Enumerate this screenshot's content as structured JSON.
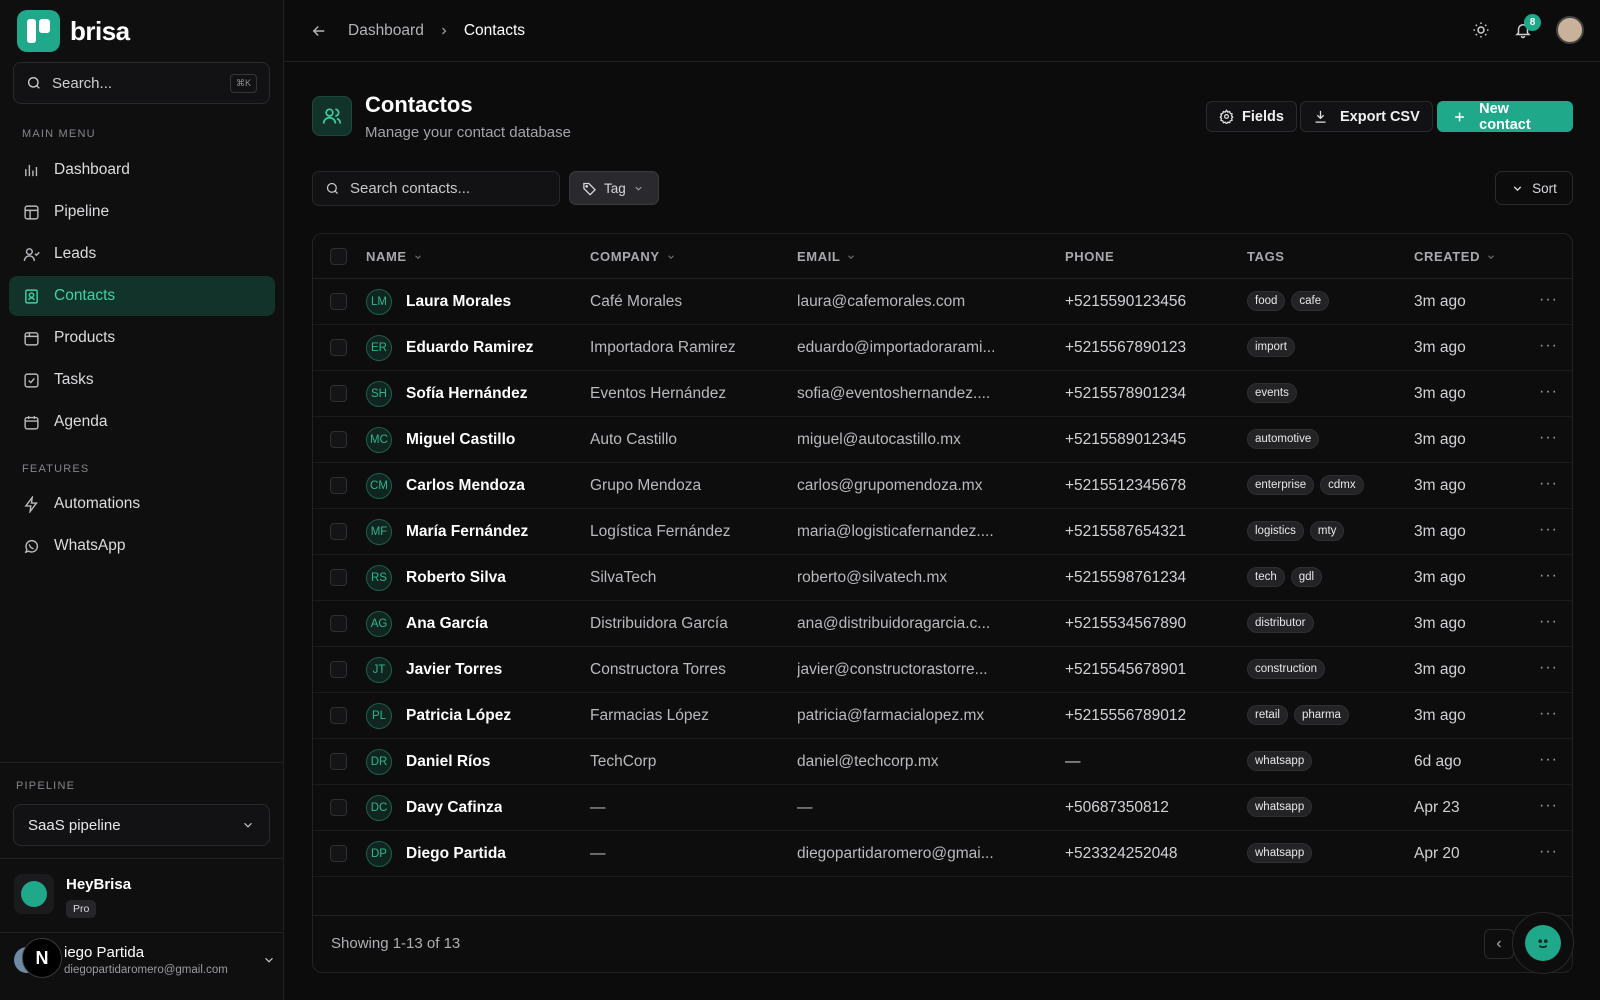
{
  "brand": {
    "name": "brisa"
  },
  "sidebar": {
    "search_placeholder": "Search...",
    "search_shortcut": "⌘K",
    "main_menu_label": "MAIN MENU",
    "main_items": [
      {
        "label": "Dashboard",
        "icon": "dashboard-icon"
      },
      {
        "label": "Pipeline",
        "icon": "pipeline-icon"
      },
      {
        "label": "Leads",
        "icon": "leads-icon"
      },
      {
        "label": "Contacts",
        "icon": "contacts-icon",
        "active": true
      },
      {
        "label": "Products",
        "icon": "products-icon"
      },
      {
        "label": "Tasks",
        "icon": "tasks-icon"
      },
      {
        "label": "Agenda",
        "icon": "calendar-icon"
      }
    ],
    "features_label": "FEATURES",
    "feature_items": [
      {
        "label": "Automations",
        "icon": "bolt-icon"
      },
      {
        "label": "WhatsApp",
        "icon": "whatsapp-icon"
      }
    ],
    "pipeline_label": "PIPELINE",
    "pipeline_selected": "SaaS pipeline",
    "org": {
      "name": "HeyBrisa",
      "plan": "Pro"
    },
    "user": {
      "name": "iego Partida",
      "email": "diegopartidaromero@gmail.com"
    },
    "next_badge": "N"
  },
  "topbar": {
    "breadcrumb": [
      "Dashboard",
      "Contacts"
    ],
    "notifications_count": "8"
  },
  "page": {
    "title": "Contactos",
    "subtitle": "Manage your contact database",
    "fields_label": "Fields",
    "export_label": "Export CSV",
    "new_label": "New contact",
    "search_placeholder": "Search contacts...",
    "tag_filter_label": "Tag",
    "sort_label": "Sort"
  },
  "table": {
    "headers": {
      "name": "NAME",
      "company": "COMPANY",
      "email": "EMAIL",
      "phone": "PHONE",
      "tags": "TAGS",
      "created": "CREATED"
    },
    "rows": [
      {
        "initials": "LM",
        "name": "Laura Morales",
        "company": "Café Morales",
        "email": "laura@cafemorales.com",
        "phone": "+5215590123456",
        "tags": [
          "food",
          "cafe"
        ],
        "created": "3m ago"
      },
      {
        "initials": "ER",
        "name": "Eduardo Ramirez",
        "company": "Importadora Ramirez",
        "email": "eduardo@importadorarami...",
        "phone": "+5215567890123",
        "tags": [
          "import"
        ],
        "created": "3m ago"
      },
      {
        "initials": "SH",
        "name": "Sofía Hernández",
        "company": "Eventos Hernández",
        "email": "sofia@eventoshernandez....",
        "phone": "+5215578901234",
        "tags": [
          "events"
        ],
        "created": "3m ago"
      },
      {
        "initials": "MC",
        "name": "Miguel Castillo",
        "company": "Auto Castillo",
        "email": "miguel@autocastillo.mx",
        "phone": "+5215589012345",
        "tags": [
          "automotive"
        ],
        "created": "3m ago"
      },
      {
        "initials": "CM",
        "name": "Carlos Mendoza",
        "company": "Grupo Mendoza",
        "email": "carlos@grupomendoza.mx",
        "phone": "+5215512345678",
        "tags": [
          "enterprise",
          "cdmx"
        ],
        "created": "3m ago"
      },
      {
        "initials": "MF",
        "name": "María Fernández",
        "company": "Logística Fernández",
        "email": "maria@logisticafernandez....",
        "phone": "+5215587654321",
        "tags": [
          "logistics",
          "mty"
        ],
        "created": "3m ago"
      },
      {
        "initials": "RS",
        "name": "Roberto Silva",
        "company": "SilvaTech",
        "email": "roberto@silvatech.mx",
        "phone": "+5215598761234",
        "tags": [
          "tech",
          "gdl"
        ],
        "created": "3m ago"
      },
      {
        "initials": "AG",
        "name": "Ana García",
        "company": "Distribuidora García",
        "email": "ana@distribuidoragarcia.c...",
        "phone": "+5215534567890",
        "tags": [
          "distributor"
        ],
        "created": "3m ago"
      },
      {
        "initials": "JT",
        "name": "Javier Torres",
        "company": "Constructora Torres",
        "email": "javier@constructorastorre...",
        "phone": "+5215545678901",
        "tags": [
          "construction"
        ],
        "created": "3m ago"
      },
      {
        "initials": "PL",
        "name": "Patricia López",
        "company": "Farmacias López",
        "email": "patricia@farmacialopez.mx",
        "phone": "+5215556789012",
        "tags": [
          "retail",
          "pharma"
        ],
        "created": "3m ago"
      },
      {
        "initials": "DR",
        "name": "Daniel Ríos",
        "company": "TechCorp",
        "email": "daniel@techcorp.mx",
        "phone": "—",
        "tags": [
          "whatsapp"
        ],
        "created": "6d ago"
      },
      {
        "initials": "DC",
        "name": "Davy Cafinza",
        "company": "—",
        "email": "—",
        "phone": "+50687350812",
        "tags": [
          "whatsapp"
        ],
        "created": "Apr 23"
      },
      {
        "initials": "DP",
        "name": "Diego Partida",
        "company": "—",
        "email": "diegopartidaromero@gmai...",
        "phone": "+523324252048",
        "tags": [
          "whatsapp"
        ],
        "created": "Apr 20"
      }
    ],
    "showing": "Showing 1-13 of 13"
  },
  "colors": {
    "accent": "#1fa88a",
    "active_bg": "#12332a",
    "active_text": "#3fd2a6"
  }
}
